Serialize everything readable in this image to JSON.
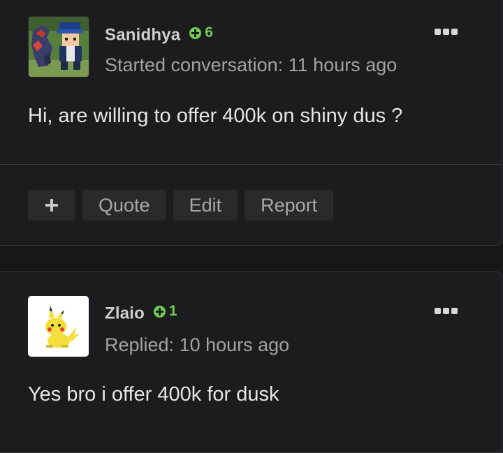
{
  "posts": [
    {
      "username": "Sanidhya",
      "reputation": "6",
      "meta": "Started conversation: 11 hours ago",
      "body": "Hi, are willing to offer 400k on shiny dus ?"
    },
    {
      "username": "Zlaio",
      "reputation": "1",
      "meta": "Replied: 10 hours ago",
      "body": "Yes bro i offer 400k for dusk"
    }
  ],
  "actions": {
    "plus_label": "+",
    "quote_label": "Quote",
    "edit_label": "Edit",
    "report_label": "Report"
  },
  "colors": {
    "background": "#171718",
    "card": "#1c1c1e",
    "reputation": "#6fcf53",
    "button": "#2a2a2c"
  },
  "icons": [
    "rep-plus-icon",
    "more-options-icon",
    "plus-icon"
  ]
}
